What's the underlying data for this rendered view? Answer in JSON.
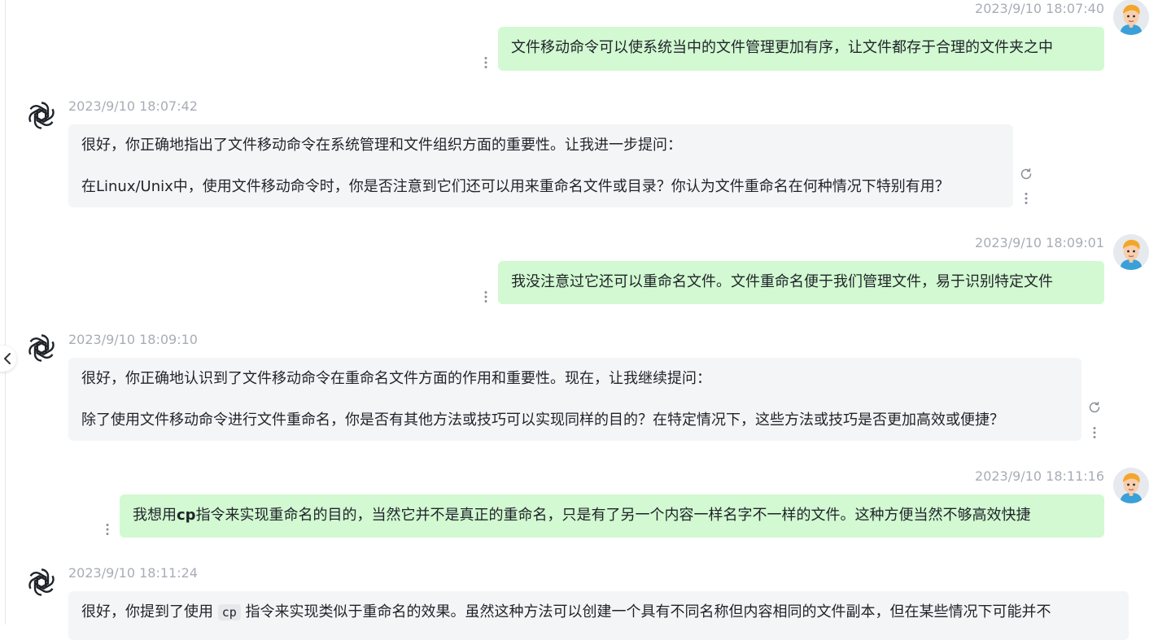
{
  "conversation": {
    "messages": [
      {
        "role": "user",
        "time": "2023/9/10 18:07:40",
        "text": "文件移动命令可以使系统当中的文件管理更加有序，让文件都存于合理的文件夹之中"
      },
      {
        "role": "assistant",
        "time": "2023/9/10 18:07:42",
        "paragraphs": [
          "很好，你正确地指出了文件移动命令在系统管理和文件组织方面的重要性。让我进一步提问：",
          "在Linux/Unix中，使用文件移动命令时，你是否注意到它们还可以用来重命名文件或目录？你认为文件重命名在何种情况下特别有用？"
        ]
      },
      {
        "role": "user",
        "time": "2023/9/10 18:09:01",
        "text": "我没注意过它还可以重命名文件。文件重命名便于我们管理文件，易于识别特定文件"
      },
      {
        "role": "assistant",
        "time": "2023/9/10 18:09:10",
        "paragraphs": [
          "很好，你正确地认识到了文件移动命令在重命名文件方面的作用和重要性。现在，让我继续提问：",
          "除了使用文件移动命令进行文件重命名，你是否有其他方法或技巧可以实现同样的目的？在特定情况下，这些方法或技巧是否更加高效或便捷？"
        ]
      },
      {
        "role": "user",
        "time": "2023/9/10 18:11:16",
        "text_prefix": "我想用",
        "text_bold": "cp",
        "text_suffix": "指令来实现重命名的目的，当然它并不是真正的重命名，只是有了另一个内容一样名字不一样的文件。这种方便当然不够高效快捷"
      },
      {
        "role": "assistant",
        "time": "2023/9/10 18:11:24",
        "text_prefix": "很好，你提到了使用 ",
        "code": "cp",
        "text_suffix": " 指令来实现类似于重命名的效果。虽然这种方法可以创建一个具有不同名称但内容相同的文件副本，但在某些情况下可能并不"
      }
    ]
  },
  "icons": {
    "assistant_avatar": "openai-logo-icon",
    "user_avatar": "cartoon-avatar",
    "more": "vertical-dots-icon",
    "regenerate": "refresh-icon",
    "collapse": "chevron-left-icon"
  },
  "colors": {
    "user_bubble": "#d2f9d1",
    "assistant_bubble": "#f4f5f7",
    "timestamp": "#a8adb5"
  }
}
